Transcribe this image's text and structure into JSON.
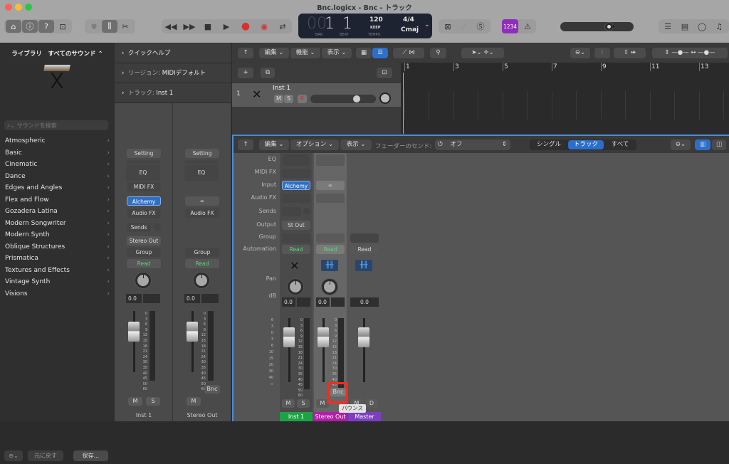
{
  "window": {
    "title": "Bnc.logicx - Bnc - トラック"
  },
  "toolbar": {
    "left_buttons": [
      "library-icon",
      "info-icon",
      "help-icon",
      "inbox-icon"
    ],
    "view_buttons": [
      "smart-controls-icon",
      "mixer-icon",
      "scissors-icon"
    ],
    "transport": [
      "rewind-icon",
      "fast-forward-icon",
      "stop-icon",
      "play-icon",
      "record-icon",
      "capture-record-icon",
      "cycle-icon"
    ],
    "lcd": {
      "bar_prefix": "00",
      "bar": "1",
      "beat": "1",
      "bar_label": "BAR",
      "beat_label": "BEAT",
      "tempo": "120",
      "tempo_mode": "KEEP",
      "tempo_label": "TEMPO",
      "signature": "4/4",
      "key": "Cmaj"
    },
    "count_in": "1234",
    "master_volume_fraction": 0.68,
    "right_buttons": [
      "list-editor-icon",
      "notepad-icon",
      "loop-browser-icon",
      "media-browser-icon"
    ]
  },
  "library": {
    "header": "ライブラリ　すべてのサウンド ⌃",
    "search_placeholder": "サウンドを検索",
    "items": [
      "Atmospheric",
      "Basic",
      "Cinematic",
      "Dance",
      "Edges and Angles",
      "Flex and Flow",
      "Gozadera Latina",
      "Modern Songwriter",
      "Modern Synth",
      "Oblique Structures",
      "Prismatica",
      "Textures and Effects",
      "Vintage Synth",
      "Visions"
    ],
    "footer": {
      "revert": "元に戻す",
      "save": "保存..."
    }
  },
  "inspector": {
    "rows": [
      {
        "label": "クイックヘルプ",
        "value": ""
      },
      {
        "label": "リージョン:",
        "value": "MIDIデフォルト"
      },
      {
        "label": "トラック:",
        "value": "Inst 1"
      }
    ],
    "strips": [
      {
        "setting": "Setting",
        "eq": "EQ",
        "midifx": "MIDI FX",
        "input": "Alchemy",
        "audiofx": "Audio FX",
        "sends": "Sends",
        "output": "Stereo Out",
        "group": "Group",
        "automation": "Read",
        "db": "0.0",
        "buttons": [
          "M",
          "S"
        ],
        "name": "Inst 1"
      },
      {
        "setting": "Setting",
        "eq": "EQ",
        "input": "∞",
        "audiofx": "Audio FX",
        "group": "Group",
        "automation": "Read",
        "db": "0.0",
        "bounce": "Bnc",
        "buttons": [
          "M"
        ],
        "name": "Stereo Out"
      }
    ],
    "scale": [
      "0",
      "3",
      "6",
      "9",
      "12",
      "15",
      "18",
      "21",
      "24",
      "30",
      "35",
      "40",
      "45",
      "50",
      "60"
    ]
  },
  "tracks": {
    "toolbar": {
      "edit": "編集",
      "functions": "機能",
      "view": "表示"
    },
    "track": {
      "number": "1",
      "name": "Inst 1",
      "mute": "M",
      "solo": "S",
      "record": "R",
      "volume_fraction": 0.72
    },
    "ruler": [
      "1",
      "3",
      "5",
      "7",
      "9",
      "11",
      "13"
    ]
  },
  "mixer": {
    "toolbar": {
      "edit": "編集",
      "options": "オプション",
      "view": "表示",
      "sends_label": "フェーダーのセンド:",
      "sends_value": "オフ",
      "tabs": [
        "シングル",
        "トラック",
        "すべて"
      ],
      "active_tab": "トラック"
    },
    "labels": [
      "EQ",
      "MIDI FX",
      "Input",
      "Audio FX",
      "Sends",
      "Output",
      "Group",
      "Automation",
      "Pan",
      "dB"
    ],
    "left_scale": [
      "6",
      "3",
      "0",
      "3",
      "6",
      "10",
      "15",
      "20",
      "30",
      "40",
      "∞"
    ],
    "channels": [
      {
        "name": "Inst 1",
        "input": "Alchemy",
        "output": "St Out",
        "automation": "Read",
        "db": "0.0",
        "buttons": [
          "M",
          "S"
        ],
        "color": "#1ea246"
      },
      {
        "name": "Stereo Out",
        "input": "∞",
        "automation": "Read",
        "db": "0.0",
        "bounce": "Bnc",
        "buttons": [
          "M"
        ],
        "color": "#b31da8"
      },
      {
        "name": "Master",
        "automation": "Read",
        "db": "0.0",
        "buttons": [
          "M",
          "D"
        ],
        "color": "#7b3fc2"
      }
    ],
    "tooltip": "バウンス"
  }
}
